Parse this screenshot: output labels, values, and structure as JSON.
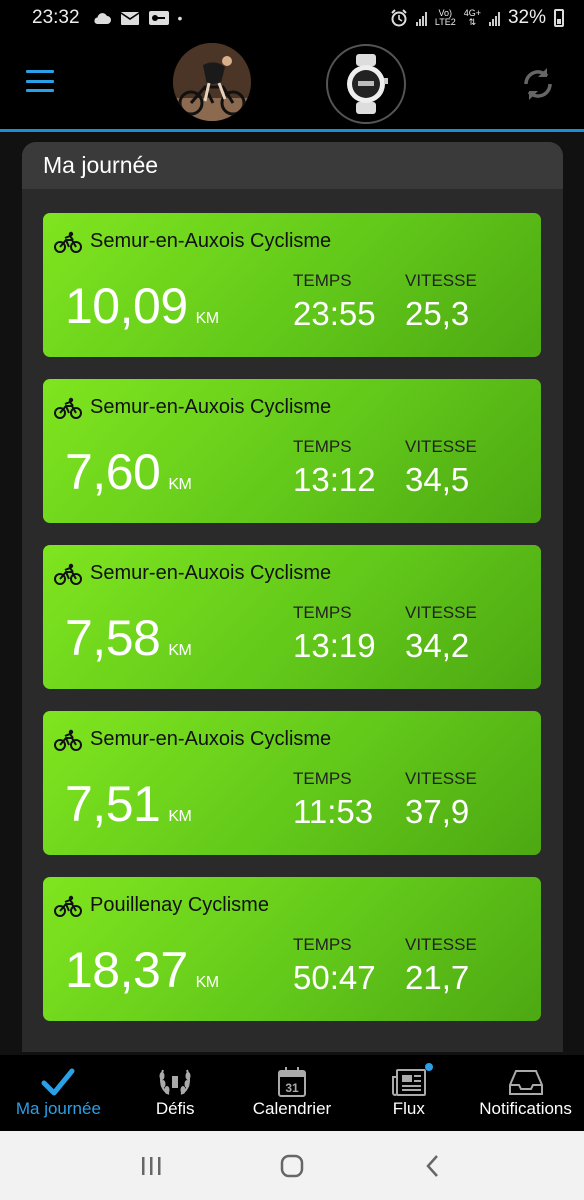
{
  "status_bar": {
    "time": "23:32",
    "network_label_top": "Vo)",
    "network_label_bottom": "LTE2",
    "data_label": "4G+",
    "battery": "32%"
  },
  "header": {
    "menu_icon": "hamburger-menu-icon",
    "device_icon": "watch-icon",
    "sync_icon": "sync-icon"
  },
  "panel": {
    "title": "Ma journée"
  },
  "activities": [
    {
      "title": "Semur-en-Auxois Cyclisme",
      "distance": "10,09",
      "unit": "KM",
      "time_label": "TEMPS",
      "time": "23:55",
      "speed_label": "VITESSE",
      "speed": "25,3"
    },
    {
      "title": "Semur-en-Auxois Cyclisme",
      "distance": "7,60",
      "unit": "KM",
      "time_label": "TEMPS",
      "time": "13:12",
      "speed_label": "VITESSE",
      "speed": "34,5"
    },
    {
      "title": "Semur-en-Auxois Cyclisme",
      "distance": "7,58",
      "unit": "KM",
      "time_label": "TEMPS",
      "time": "13:19",
      "speed_label": "VITESSE",
      "speed": "34,2"
    },
    {
      "title": "Semur-en-Auxois Cyclisme",
      "distance": "7,51",
      "unit": "KM",
      "time_label": "TEMPS",
      "time": "11:53",
      "speed_label": "VITESSE",
      "speed": "37,9"
    },
    {
      "title": "Pouillenay Cyclisme",
      "distance": "18,37",
      "unit": "KM",
      "time_label": "TEMPS",
      "time": "50:47",
      "speed_label": "VITESSE",
      "speed": "21,7"
    }
  ],
  "bottom_nav": [
    {
      "label": "Ma journée",
      "icon": "checkmark-icon",
      "active": true
    },
    {
      "label": "Défis",
      "icon": "laurel-icon",
      "active": false
    },
    {
      "label": "Calendrier",
      "icon": "calendar-icon",
      "calendar_day": "31",
      "active": false
    },
    {
      "label": "Flux",
      "icon": "news-feed-icon",
      "active": false
    },
    {
      "label": "Notifications",
      "icon": "inbox-tray-icon",
      "active": false
    }
  ],
  "colors": {
    "accent": "#2aa0e6",
    "card_green": "#6fd61c",
    "background": "#111111"
  }
}
